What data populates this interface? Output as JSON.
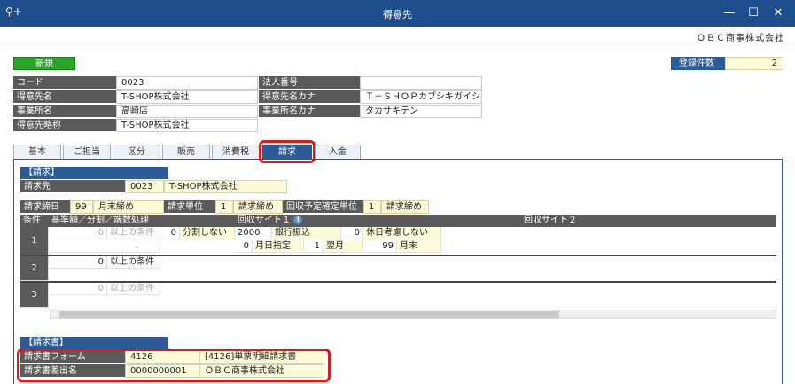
{
  "window": {
    "title": "得意先",
    "company": "ＯＢＣ商事株式会社"
  },
  "toolbar": {
    "new_label": "新規",
    "reg_count_label": "登録件数",
    "reg_count": "2"
  },
  "header_fields": {
    "code_label": "コード",
    "code": "0023",
    "name_label": "得意先名",
    "name": "T-SHOP株式会社",
    "office_label": "事業所名",
    "office": "高崎店",
    "short_label": "得意先略称",
    "short": "T-SHOP株式会社",
    "corp_no_label": "法人番号",
    "corp_no": "",
    "kana_label": "得意先名カナ",
    "kana": "Ｔ－ＳＨＯＰカブシキガイシ",
    "office_kana_label": "事業所名カナ",
    "office_kana": "タカサキテン"
  },
  "tabs": [
    "基本",
    "ご担当",
    "区分",
    "販売",
    "消費税",
    "請求",
    "入金"
  ],
  "billing": {
    "section_title": "【請求】",
    "bill_to_label": "請求先",
    "bill_to_code": "0023",
    "bill_to_name": "T-SHOP株式会社",
    "closing_day_label": "請求締日",
    "closing_day": "99",
    "closing_day_text": "月末締め",
    "unit_label": "請求単位",
    "unit_val": "1",
    "unit_text": "請求締め",
    "collect_unit_label": "回収予定確定単位",
    "collect_unit_val": "1",
    "collect_unit_text": "請求締め",
    "grid_headers": [
      "条件",
      "基準額／分割／端数処理",
      "回収サイト１",
      "回収サイト２"
    ],
    "rows": [
      {
        "num": "1",
        "amount": "0",
        "cond": "以上の条件",
        "split_val": "0",
        "split_text": "分割しない",
        "s1_code": "2000",
        "s1_method": "銀行振込",
        "s1_hol_val": "0",
        "s1_hol_text": "休日考慮しない",
        "s1_month_val": "0",
        "s1_month_text": "月日指定",
        "s1_m_val": "1",
        "s1_m_text": "翌月",
        "s1_d_val": "99",
        "s1_d_text": "月末"
      },
      {
        "num": "2",
        "amount": "0",
        "cond": "以上の条件"
      },
      {
        "num": "3",
        "amount": "0",
        "cond": "以上の条件"
      }
    ]
  },
  "invoice": {
    "section_title": "【請求書】",
    "form_label": "請求書フォーム",
    "form_code": "4126",
    "form_name": "[4126]単票明細請求書",
    "sender_label": "請求書差出名",
    "sender_code": "0000000001",
    "sender_name": "ＯＢＣ商事株式会社"
  },
  "colors": {
    "titlebar": "#1e4f8c",
    "accent": "#2c5c98",
    "new_button": "#2aa52a",
    "highlight_outline": "#d81b1b"
  }
}
